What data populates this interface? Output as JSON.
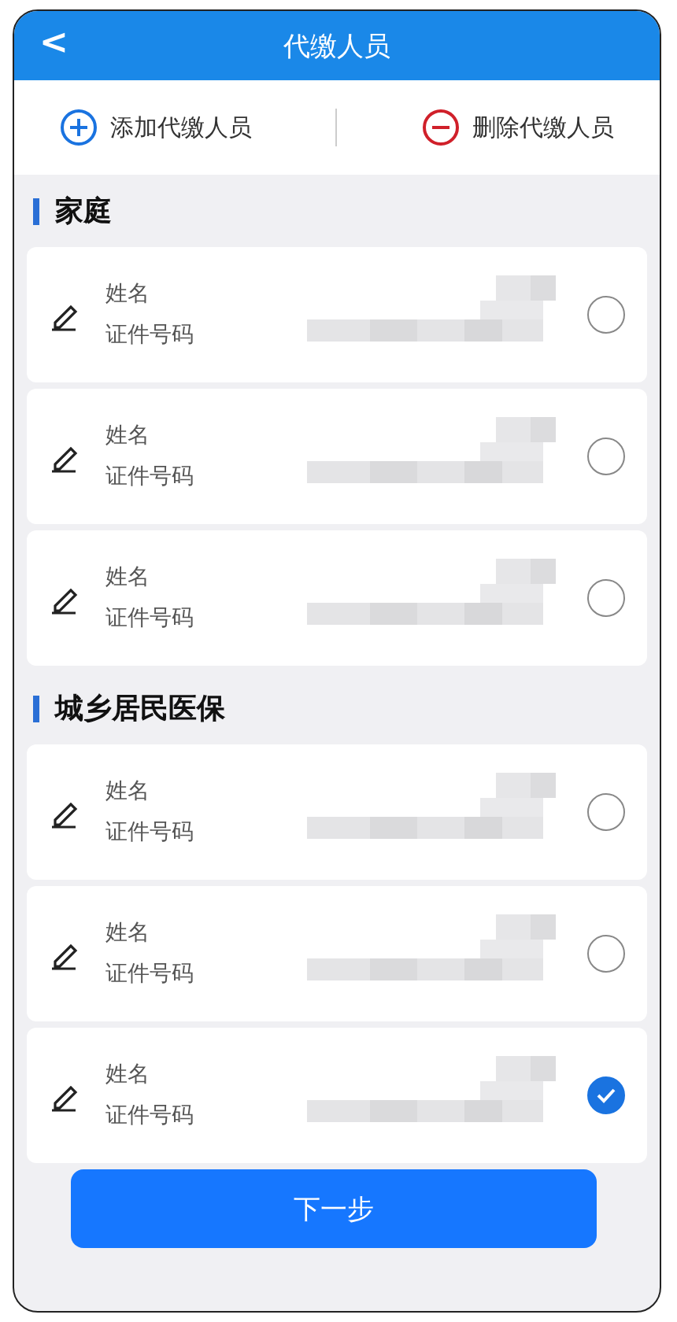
{
  "header": {
    "back": "<",
    "title": "代缴人员"
  },
  "actions": [
    {
      "kind": "add",
      "label": "添加代缴人员"
    },
    {
      "kind": "delete",
      "label": "删除代缴人员"
    }
  ],
  "groups": [
    {
      "title": "家庭",
      "members": [
        {
          "name_label": "姓名",
          "id_label": "证件号码",
          "selected": false
        },
        {
          "name_label": "姓名",
          "id_label": "证件号码",
          "selected": false
        },
        {
          "name_label": "姓名",
          "id_label": "证件号码",
          "selected": false
        }
      ]
    },
    {
      "title": "城乡居民医保",
      "members": [
        {
          "name_label": "姓名",
          "id_label": "证件号码",
          "selected": false
        },
        {
          "name_label": "姓名",
          "id_label": "证件号码",
          "selected": false
        },
        {
          "name_label": "姓名",
          "id_label": "证件号码",
          "selected": true
        }
      ]
    }
  ],
  "next_button": "下一步"
}
